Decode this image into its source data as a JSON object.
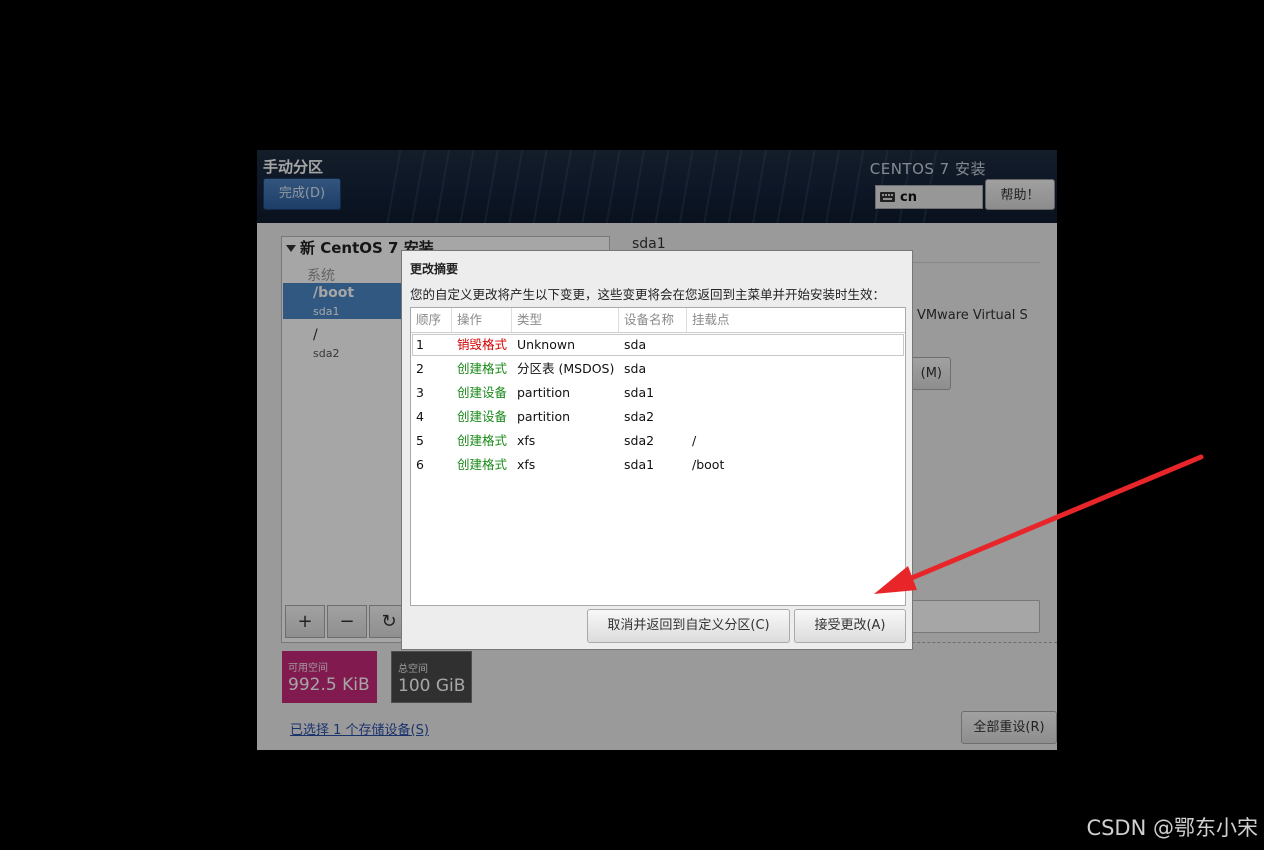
{
  "header": {
    "title": "手动分区",
    "done_button": "完成(D)",
    "product": "CENTOS 7 安装",
    "keyboard_layout": "cn",
    "help_button": "帮助！"
  },
  "left_panel": {
    "group_title": "新 CentOS 7 安装",
    "category": "系统",
    "partitions": [
      {
        "mount": "/boot",
        "device": "sda1",
        "selected": true
      },
      {
        "mount": "/",
        "device": "sda2",
        "selected": false
      }
    ],
    "toolbar": {
      "add": "+",
      "remove": "−",
      "refresh": "↻"
    }
  },
  "space": {
    "available_label": "可用空间",
    "available_value": "992.5 KiB",
    "total_label": "总空间",
    "total_value": "100 GiB"
  },
  "storage_link": "已选择 1 个存储设备(S)",
  "reset_button": "全部重设(R)",
  "right_panel": {
    "title": "sda1",
    "device_text": "VMware Virtual S",
    "modify_button": "(M)",
    "label_colon": "："
  },
  "dialog": {
    "title": "更改摘要",
    "message": "您的自定义更改将产生以下变更，这些变更将会在您返回到主菜单并开始安装时生效：",
    "columns": [
      "顺序",
      "操作",
      "类型",
      "设备名称",
      "挂载点"
    ],
    "rows": [
      {
        "order": "1",
        "action": "销毁格式",
        "action_kind": "destroy",
        "type": "Unknown",
        "device": "sda",
        "mount": ""
      },
      {
        "order": "2",
        "action": "创建格式",
        "action_kind": "create",
        "type": "分区表 (MSDOS)",
        "device": "sda",
        "mount": ""
      },
      {
        "order": "3",
        "action": "创建设备",
        "action_kind": "create",
        "type": "partition",
        "device": "sda1",
        "mount": ""
      },
      {
        "order": "4",
        "action": "创建设备",
        "action_kind": "create",
        "type": "partition",
        "device": "sda2",
        "mount": ""
      },
      {
        "order": "5",
        "action": "创建格式",
        "action_kind": "create",
        "type": "xfs",
        "device": "sda2",
        "mount": "/"
      },
      {
        "order": "6",
        "action": "创建格式",
        "action_kind": "create",
        "type": "xfs",
        "device": "sda1",
        "mount": "/boot"
      }
    ],
    "cancel_button": "取消并返回到自定义分区(C)",
    "accept_button": "接受更改(A)"
  },
  "colors": {
    "destroy": "#d40000",
    "create": "#1a8a1a",
    "selection": "#4a88c7",
    "available_bg": "#c5287a",
    "arrow": "#e8262a"
  },
  "watermark": "CSDN @鄂东小宋"
}
